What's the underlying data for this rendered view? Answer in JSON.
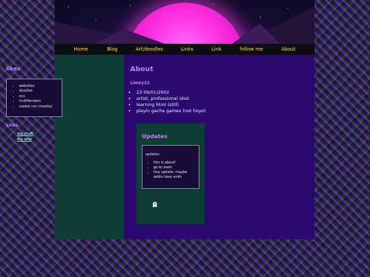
{
  "nav": {
    "items": [
      "Home",
      "Blog",
      "Art/doodles",
      "Links",
      "Link",
      "follow me",
      "About"
    ]
  },
  "sidebar": {
    "likes_heading": "likes",
    "likes": [
      "websites",
      "doodles",
      "ocs",
      "multifandom",
      "cookie run (mostly)"
    ],
    "links_heading": "Links",
    "links": [
      "my stuff",
      "my arts"
    ]
  },
  "main": {
    "heading": "About",
    "subheading": "Limey23",
    "facts": [
      "23 09/01/2002",
      "artist, professional idiot",
      "learning html (still)",
      "playin gacha games (not hoyo)"
    ]
  },
  "updates": {
    "heading": "Updates",
    "box_title": "updates:",
    "items": [
      "this is about!",
      "go to main",
      "tiny update: maybe addin here smth"
    ]
  },
  "icons": {
    "ghost": "ghost-icon",
    "sun": "sun-graphic"
  },
  "colors": {
    "accent_heading": "#c77dff",
    "nav_text": "#ffe16a",
    "sidebar_bg": "#0d3d34",
    "main_bg": "#2a0a6e",
    "link_color": "#7fe0d0"
  }
}
